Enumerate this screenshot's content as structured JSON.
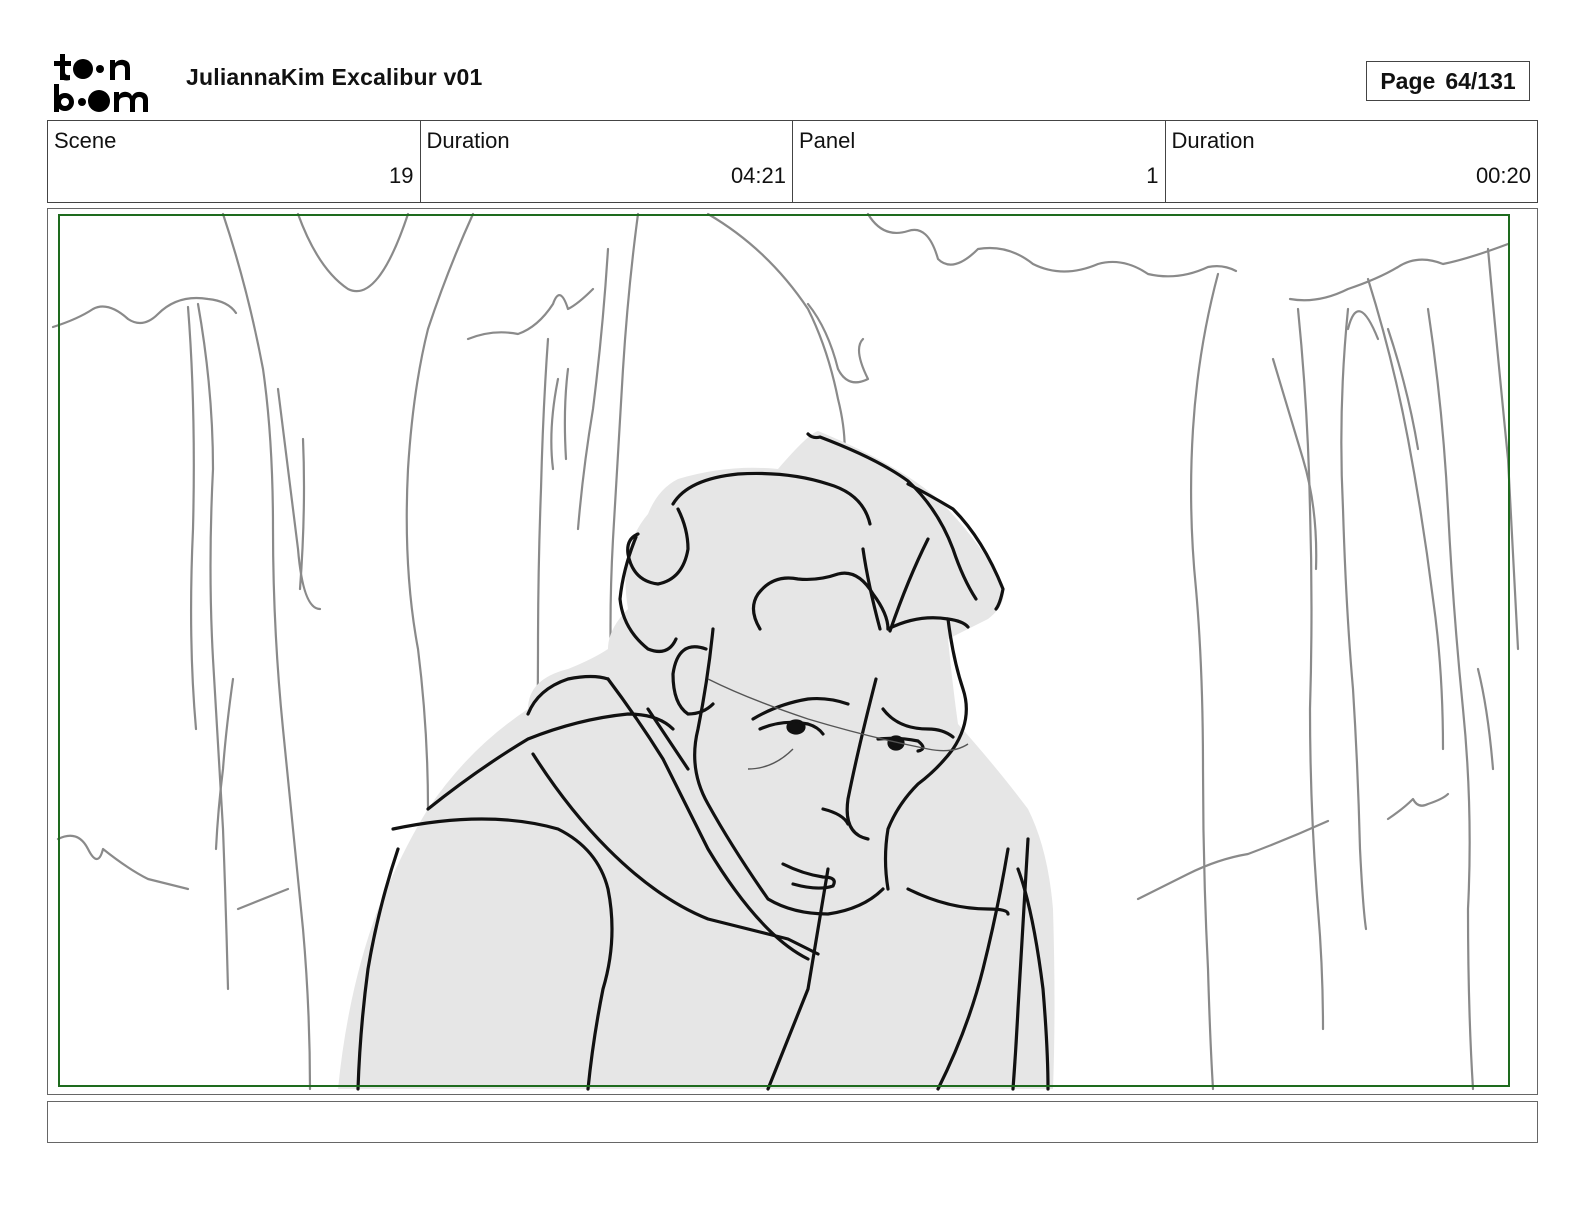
{
  "header": {
    "logo_text_top": "toon",
    "logo_text_bottom": "boom",
    "project_title": "JuliannaKim Excalibur v01",
    "page_label": "Page",
    "page_value": "64/131"
  },
  "info": {
    "scene_label": "Scene",
    "scene_value": "19",
    "scene_duration_label": "Duration",
    "scene_duration_value": "04:21",
    "panel_label": "Panel",
    "panel_value": "1",
    "panel_duration_label": "Duration",
    "panel_duration_value": "00:20"
  },
  "panel": {
    "safe_frame_color": "#1e6b1e",
    "sketch_stroke_light": "#8a8a8a",
    "sketch_stroke_dark": "#111111",
    "figure_fill": "#e6e6e6"
  },
  "notes": {
    "text": ""
  }
}
